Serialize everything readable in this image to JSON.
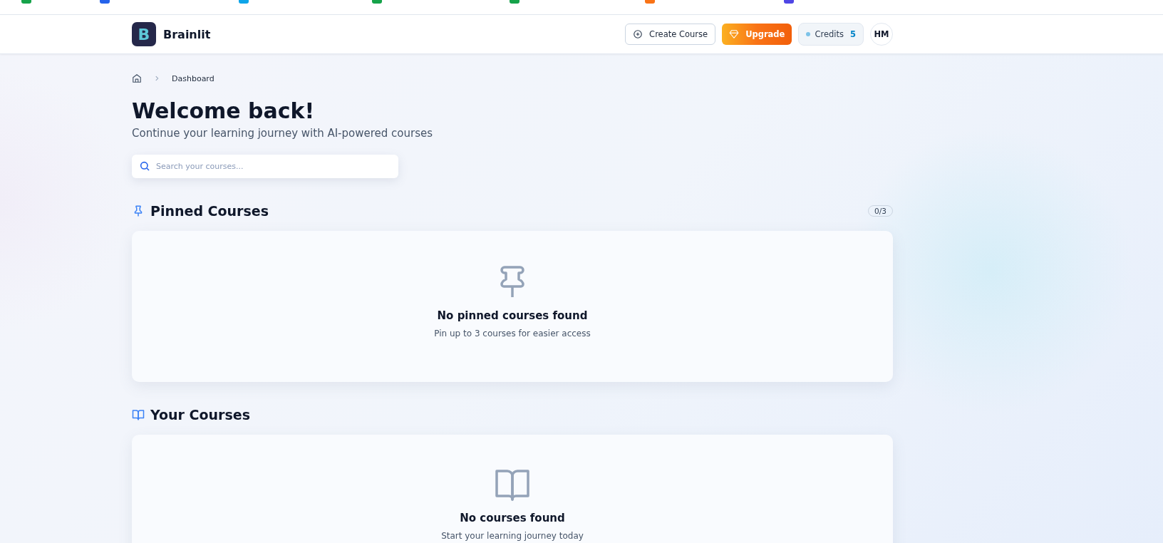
{
  "bookmarks_bar": [
    {
      "color": "#16a34a"
    },
    {
      "color": "#2563eb"
    },
    {
      "color": "#0ea5e9"
    },
    {
      "color": "#16a34a"
    },
    {
      "color": "#16a34a"
    },
    {
      "color": "#f97316"
    },
    {
      "color": "#4f46e5"
    }
  ],
  "header": {
    "logo_letter": "B",
    "brand": "Brainlit",
    "create_button": "Create Course",
    "upgrade_button": "Upgrade",
    "credits_label": "Credits",
    "credits_value": "5",
    "avatar_initials": "HM"
  },
  "breadcrumb": {
    "current": "Dashboard"
  },
  "title": "Welcome back!",
  "subtitle": "Continue your learning journey with AI-powered courses",
  "search": {
    "placeholder": "Search your courses..."
  },
  "sections": [
    {
      "kind": "pinned",
      "heading": "Pinned Courses",
      "count": "0/3",
      "empty_title": "No pinned courses found",
      "empty_text": "Pin up to 3 courses for easier access"
    },
    {
      "kind": "courses",
      "heading": "Your Courses",
      "empty_title": "No courses found",
      "empty_text": "Start your learning journey today"
    }
  ]
}
